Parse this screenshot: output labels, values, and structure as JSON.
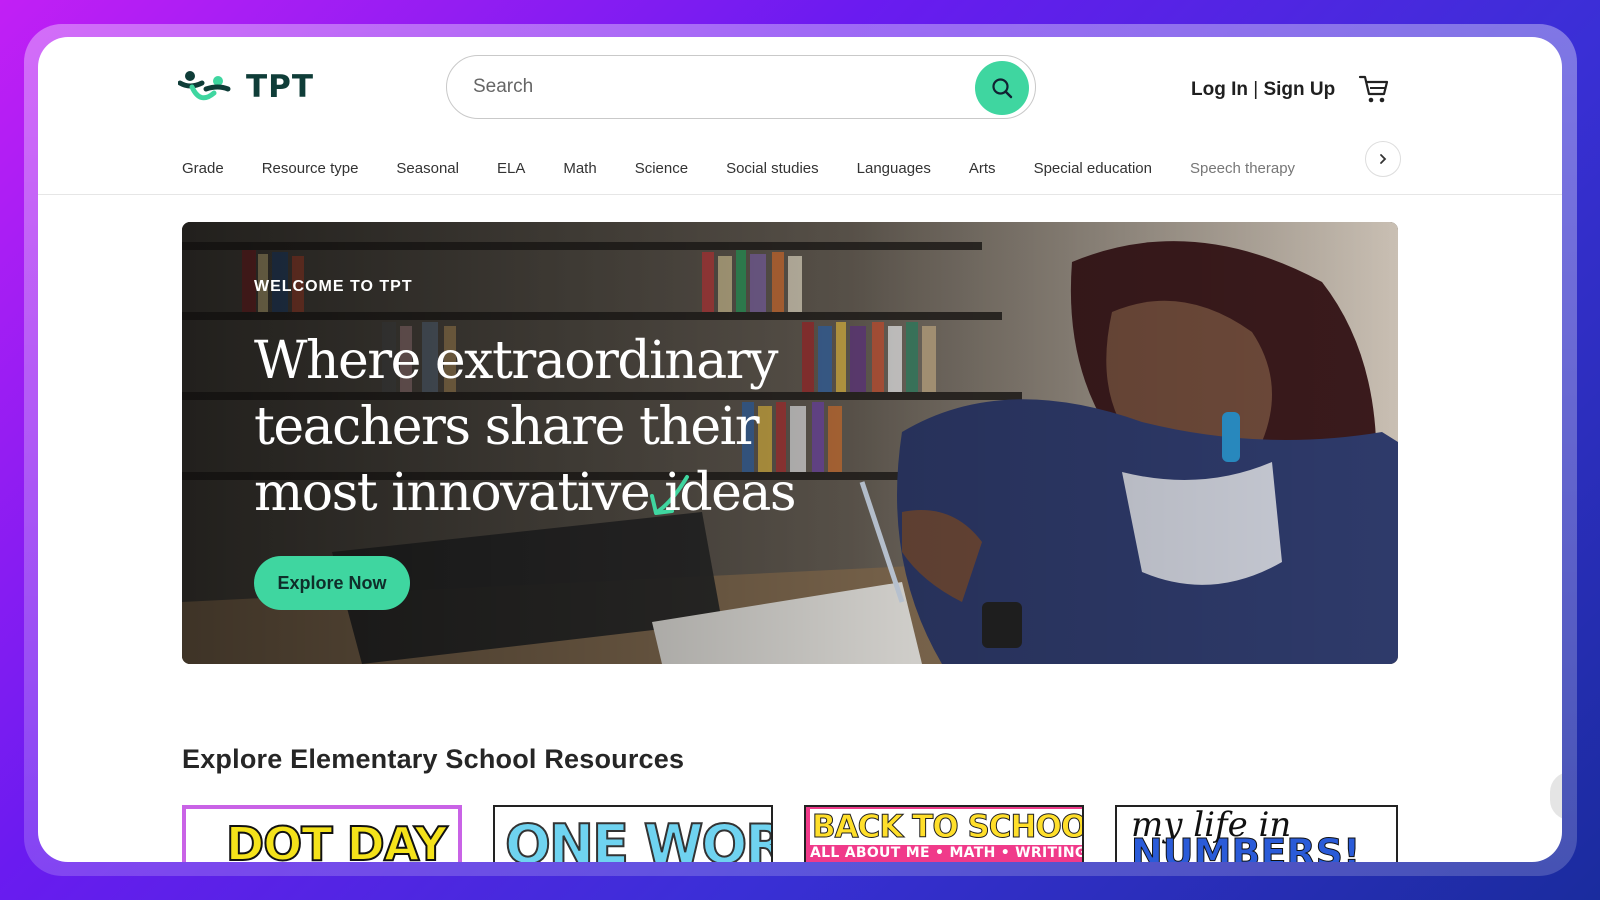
{
  "brand": {
    "name": "TPT",
    "accent": "#3fd6a0",
    "dark": "#0f3d38"
  },
  "header": {
    "search_placeholder": "Search",
    "login_label": "Log In",
    "separator": " | ",
    "signup_label": "Sign Up"
  },
  "nav": {
    "items": [
      "Grade",
      "Resource type",
      "Seasonal",
      "ELA",
      "Math",
      "Science",
      "Social studies",
      "Languages",
      "Arts",
      "Special education",
      "Speech therapy"
    ]
  },
  "hero": {
    "kicker": "WELCOME TO TPT",
    "title": "Where extraordinary teachers share their most innovative ideas",
    "cta": "Explore Now"
  },
  "section": {
    "title": "Explore Elementary School Resources"
  },
  "cards": [
    {
      "text": "DOT DAY"
    },
    {
      "text": "ONE WORD"
    },
    {
      "text": "BACK TO SCHOOL",
      "subtext": "ALL ABOUT ME • MATH • WRITING"
    },
    {
      "text": "my life in",
      "subtext": "NUMBERS!"
    }
  ]
}
